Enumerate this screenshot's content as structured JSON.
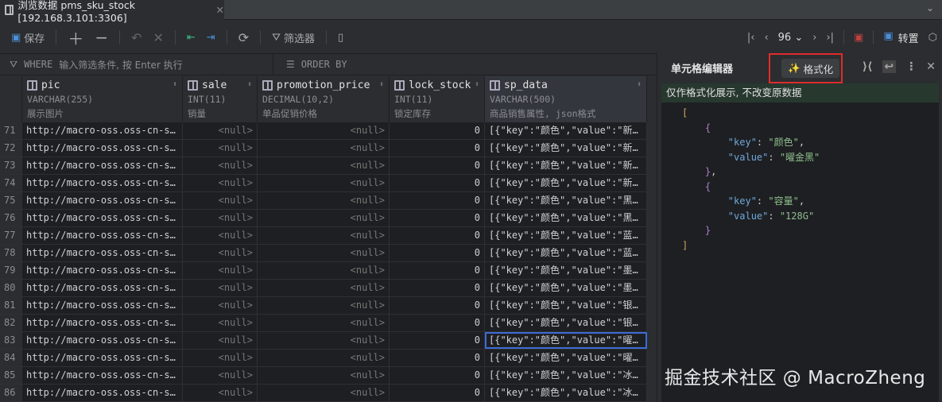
{
  "tab": {
    "title": "浏览数据 pms_sku_stock [192.168.3.101:3306]"
  },
  "toolbar": {
    "save": "保存",
    "filter": "筛选器",
    "page": "96",
    "transpose": "转置"
  },
  "filterbar": {
    "where_label": "WHERE",
    "where_placeholder": "输入筛选条件, 按 Enter 执行",
    "order_label": "ORDER BY"
  },
  "columns": [
    {
      "name": "pic",
      "type": "VARCHAR(255)",
      "comment": "展示图片"
    },
    {
      "name": "sale",
      "type": "INT(11)",
      "comment": "销量"
    },
    {
      "name": "promotion_price",
      "type": "DECIMAL(10,2)",
      "comment": "单品促销价格"
    },
    {
      "name": "lock_stock",
      "type": "INT(11)",
      "comment": "锁定库存"
    },
    {
      "name": "sp_data",
      "type": "VARCHAR(500)",
      "comment": "商品销售属性, json格式"
    }
  ],
  "rows": [
    {
      "n": "71",
      "pic": "http://macro-oss.oss-cn-s…",
      "sale": "<null>",
      "promo": "<null>",
      "lock": "0",
      "sp": "[{\"key\":\"颜色\",\"value\":\"新…"
    },
    {
      "n": "72",
      "pic": "http://macro-oss.oss-cn-s…",
      "sale": "<null>",
      "promo": "<null>",
      "lock": "0",
      "sp": "[{\"key\":\"颜色\",\"value\":\"新…"
    },
    {
      "n": "73",
      "pic": "http://macro-oss.oss-cn-s…",
      "sale": "<null>",
      "promo": "<null>",
      "lock": "0",
      "sp": "[{\"key\":\"颜色\",\"value\":\"新…"
    },
    {
      "n": "74",
      "pic": "http://macro-oss.oss-cn-s…",
      "sale": "<null>",
      "promo": "<null>",
      "lock": "0",
      "sp": "[{\"key\":\"颜色\",\"value\":\"新…"
    },
    {
      "n": "75",
      "pic": "http://macro-oss.oss-cn-s…",
      "sale": "<null>",
      "promo": "<null>",
      "lock": "0",
      "sp": "[{\"key\":\"颜色\",\"value\":\"黑…"
    },
    {
      "n": "76",
      "pic": "http://macro-oss.oss-cn-s…",
      "sale": "<null>",
      "promo": "<null>",
      "lock": "0",
      "sp": "[{\"key\":\"颜色\",\"value\":\"黑…"
    },
    {
      "n": "77",
      "pic": "http://macro-oss.oss-cn-s…",
      "sale": "<null>",
      "promo": "<null>",
      "lock": "0",
      "sp": "[{\"key\":\"颜色\",\"value\":\"蓝…"
    },
    {
      "n": "78",
      "pic": "http://macro-oss.oss-cn-s…",
      "sale": "<null>",
      "promo": "<null>",
      "lock": "0",
      "sp": "[{\"key\":\"颜色\",\"value\":\"蓝…"
    },
    {
      "n": "79",
      "pic": "http://macro-oss.oss-cn-s…",
      "sale": "<null>",
      "promo": "<null>",
      "lock": "0",
      "sp": "[{\"key\":\"颜色\",\"value\":\"墨…"
    },
    {
      "n": "80",
      "pic": "http://macro-oss.oss-cn-s…",
      "sale": "<null>",
      "promo": "<null>",
      "lock": "0",
      "sp": "[{\"key\":\"颜色\",\"value\":\"墨…"
    },
    {
      "n": "81",
      "pic": "http://macro-oss.oss-cn-s…",
      "sale": "<null>",
      "promo": "<null>",
      "lock": "0",
      "sp": "[{\"key\":\"颜色\",\"value\":\"银…"
    },
    {
      "n": "82",
      "pic": "http://macro-oss.oss-cn-s…",
      "sale": "<null>",
      "promo": "<null>",
      "lock": "0",
      "sp": "[{\"key\":\"颜色\",\"value\":\"银…"
    },
    {
      "n": "83",
      "pic": "http://macro-oss.oss-cn-s…",
      "sale": "<null>",
      "promo": "<null>",
      "lock": "0",
      "sp": "[{\"key\":\"颜色\",\"value\":\"曜…",
      "selected": true
    },
    {
      "n": "84",
      "pic": "http://macro-oss.oss-cn-s…",
      "sale": "<null>",
      "promo": "<null>",
      "lock": "0",
      "sp": "[{\"key\":\"颜色\",\"value\":\"曜…"
    },
    {
      "n": "85",
      "pic": "http://macro-oss.oss-cn-s…",
      "sale": "<null>",
      "promo": "<null>",
      "lock": "0",
      "sp": "[{\"key\":\"颜色\",\"value\":\"冰…"
    },
    {
      "n": "86",
      "pic": "http://macro-oss.oss-cn-s…",
      "sale": "<null>",
      "promo": "<null>",
      "lock": "0",
      "sp": "[{\"key\":\"颜色\",\"value\":\"冰…"
    }
  ],
  "panel": {
    "title": "单元格编辑器",
    "format_button": "格式化",
    "banner": "仅作格式化展示, 不改变原数据",
    "json": [
      {
        "key": "颜色",
        "value": "曜金黑"
      },
      {
        "key": "容量",
        "value": "128G"
      }
    ]
  },
  "watermark": "掘金技术社区 @ MacroZheng"
}
